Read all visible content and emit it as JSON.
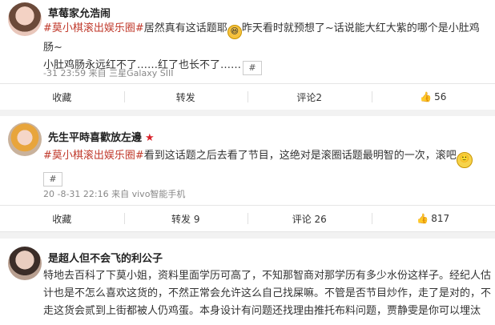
{
  "posts": [
    {
      "username": "草莓家允浩闹",
      "line1_topic": "#莫小棋滚出娱乐圈#",
      "line1_text": "居然真有这话题耶",
      "line1_text2": "昨天看时就预想了~话说能大红大紫的哪个是小肚鸡肠~",
      "line2_text": "小肚鸡肠永远红不了……红了也长不了……",
      "hash_box": "#",
      "meta": "-31 23:59  来自  三星Galaxy SIII",
      "actions": {
        "favorite": "收藏",
        "repost": "转发",
        "comment": "评论2",
        "like": "56"
      }
    },
    {
      "username": "先生平時喜歡放左邊",
      "line1_topic": "#莫小棋滚出娱乐圈#",
      "line1_text": "看到这话题之后去看了节目，这绝对是滚圈话题最明智的一次，滚吧",
      "line2_text": "",
      "hash_box": "#",
      "meta": "20  -8-31 22:16  来自  vivo智能手机",
      "actions": {
        "favorite": "收藏",
        "repost": "转发 9",
        "comment": "评论 26",
        "like": "817"
      }
    },
    {
      "username": "是超人但不会飞的利公子",
      "line1_text": "特地去百科了下莫小姐，资料里面学历可高了，不知那智商对那学历有多少水份这样子。经纪人估",
      "line2_text": "计也是不怎么喜欢这货的，不然正常会允许这么自己找屎嘛。不管是否节目炒作，走了是对的，不",
      "line3_text": "走这货会贰到上街都被人仍鸡蛋。本身设计有问题还找理由推托布料问题，贾静雯是你可以埋汰"
    }
  ],
  "icons": {
    "like": "thumbs-up-icon",
    "star": "star-icon",
    "emoji_laugh": "laughing-emoji-icon",
    "emoji_smile": "smiling-emoji-icon"
  },
  "colors": {
    "topic": "#c0392b",
    "star": "#d9232b"
  }
}
